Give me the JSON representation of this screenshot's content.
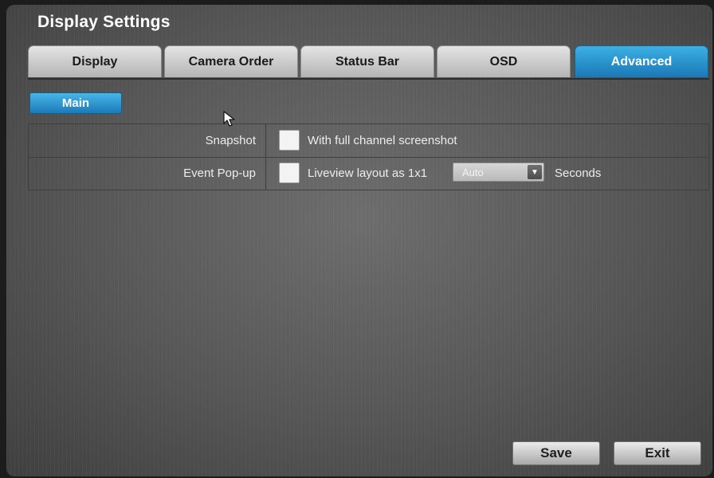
{
  "window": {
    "title": "Display Settings"
  },
  "tabs": [
    {
      "label": "Display",
      "active": false
    },
    {
      "label": "Camera Order",
      "active": false
    },
    {
      "label": "Status Bar",
      "active": false
    },
    {
      "label": "OSD",
      "active": false
    },
    {
      "label": "Advanced",
      "active": true
    }
  ],
  "subtab": {
    "label": "Main"
  },
  "settings": {
    "snapshot": {
      "label": "Snapshot",
      "checkbox_label": "With full channel screenshot",
      "checked": false
    },
    "event_popup": {
      "label": "Event Pop-up",
      "checkbox_label": "Liveview layout as 1x1",
      "checked": false,
      "duration_value": "Auto",
      "duration_unit": "Seconds"
    }
  },
  "buttons": {
    "save": "Save",
    "exit": "Exit"
  },
  "colors": {
    "accent": "#1b78b6",
    "accent_light": "#3bb0e3",
    "panel": "#565656"
  },
  "icons": {
    "dropdown": "chevron-down-icon",
    "pointer": "mouse-cursor-icon"
  }
}
